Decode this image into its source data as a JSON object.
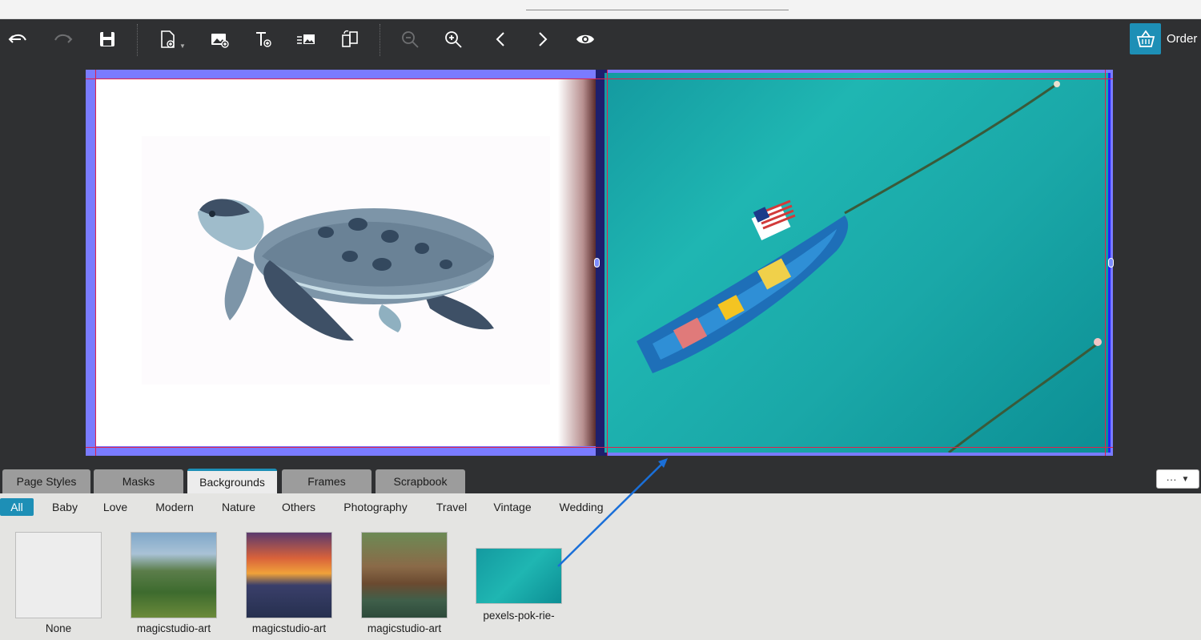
{
  "toolbar": {
    "undo": "undo-icon",
    "redo": "redo-icon",
    "save": "save-icon",
    "add_page": "add-page-icon",
    "add_photo": "add-photo-icon",
    "add_text": "add-text-icon",
    "text_photo": "text-photo-icon",
    "swap_pages": "swap-pages-icon",
    "zoom_out": "zoom-out-icon",
    "zoom_in": "zoom-in-icon",
    "prev": "chevron-left-icon",
    "next": "chevron-right-icon",
    "preview": "eye-icon",
    "order_label": "Order"
  },
  "tabs": [
    {
      "label": "Page Styles",
      "active": false
    },
    {
      "label": "Masks",
      "active": false
    },
    {
      "label": "Backgrounds",
      "active": true
    },
    {
      "label": "Frames",
      "active": false
    },
    {
      "label": "Scrapbook",
      "active": false
    }
  ],
  "more_button": "···",
  "categories": [
    {
      "label": "All",
      "active": true
    },
    {
      "label": "Baby"
    },
    {
      "label": "Love"
    },
    {
      "label": "Modern"
    },
    {
      "label": "Nature"
    },
    {
      "label": "Others"
    },
    {
      "label": "Photography"
    },
    {
      "label": "Travel"
    },
    {
      "label": "Vintage"
    },
    {
      "label": "Wedding"
    }
  ],
  "backgrounds": [
    {
      "label": "None"
    },
    {
      "label": "magicstudio-art"
    },
    {
      "label": "magicstudio-art"
    },
    {
      "label": "magicstudio-art"
    },
    {
      "label": "pexels-pok-rie-"
    }
  ],
  "colors": {
    "accent": "#1d8fb6",
    "workarea": "#2f3032",
    "guide": "#e0204a",
    "bleed": "#7a7bff",
    "arrow": "#1a6fd8"
  }
}
